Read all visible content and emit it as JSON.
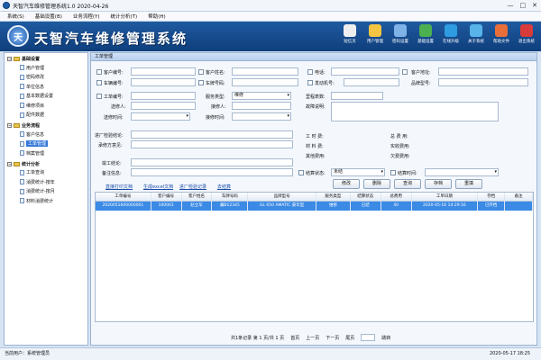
{
  "window": {
    "title": "天智汽车维修管理系统1.0 2020-04-26",
    "min_glyph": "—",
    "max_glyph": "□",
    "close_glyph": "✕"
  },
  "menu": [
    "系统(S)",
    "基础设置(B)",
    "业务流程(Y)",
    "统计分析(T)",
    "帮助(H)"
  ],
  "banner": {
    "title": "天智汽车维修管理系统",
    "logo_glyph": "天"
  },
  "toolbar": [
    {
      "label": "短信页",
      "color": "#eeeeee"
    },
    {
      "label": "用户管理",
      "color": "#f4c542"
    },
    {
      "label": "密码设置",
      "color": "#7fb3e8"
    },
    {
      "label": "基础设置",
      "color": "#4caf50"
    },
    {
      "label": "在线升级",
      "color": "#2f9be0"
    },
    {
      "label": "关于系统",
      "color": "#58b4e8"
    },
    {
      "label": "帮助文件",
      "color": "#e86f3a"
    },
    {
      "label": "退出系统",
      "color": "#d93a3a"
    }
  ],
  "sidebar": {
    "categories": [
      {
        "label": "基础设置",
        "items": [
          "用户管理",
          "密码修改",
          "单位信息",
          "基本数据设置",
          "维修项目",
          "配件数据"
        ]
      },
      {
        "label": "业务流程",
        "items": [
          "客户信息",
          "工单管理",
          "档案管理"
        ]
      },
      {
        "label": "统计分析",
        "items": [
          "工单查询",
          "消费统计-按年",
          "消费统计-按月",
          "材料消费统计"
        ]
      }
    ],
    "selected": "工单管理"
  },
  "panel": {
    "title": "工单管理"
  },
  "form": {
    "customer_id": "客户编号:",
    "customer_name": "客户姓名:",
    "phone": "电话:",
    "customer_address": "客户地址:",
    "vehicle_id": "车辆编号:",
    "plate_no": "车牌号码:",
    "engine_no": "发动机号:",
    "model_no": "品牌型号:",
    "order_id": "工单编号:",
    "service_type": "服务类型:",
    "service_type_value": "维修",
    "mileage": "里程表数:",
    "sender": "送修人:",
    "receiver": "接修人:",
    "fault_desc": "故障说明:",
    "send_time": "送修时间:",
    "receive_time": "接修时间:",
    "inspection": "进厂检验结论:",
    "labor_fee": "工 时 费:",
    "total_fee": "总 费 用:",
    "plan": "承修方意见:",
    "material_fee": "材 料 费:",
    "paid": "实收费用:",
    "other_fee": "其他费用:",
    "arrears": "欠费费用:",
    "completion": "竣工结论:",
    "remark": "备注信息:",
    "settle_status": "结算状态:",
    "settle_status_value": "未结",
    "settle_time": "结算时间:"
  },
  "links": [
    "直接打印文档",
    "生成excel文档",
    "进厂检验记录",
    "去结算"
  ],
  "buttons": [
    "修改",
    "删除",
    "查询",
    "存档",
    "重填"
  ],
  "table": {
    "columns": [
      "工单编号",
      "客户编号",
      "客户姓名",
      "车牌号码",
      "品牌型号",
      "服务类型",
      "结算状态",
      "总费用",
      "工单日期",
      "存档",
      "备注"
    ],
    "rows": [
      [
        "2020051600000001",
        "100001",
        "赵立军",
        "冀B12345",
        "GL 650 AMATIC 豪华型",
        "维修",
        "已结",
        "40",
        "2020-05-16 14:29:16",
        "已存档",
        ""
      ]
    ]
  },
  "pager": {
    "summary": "共1条记录 第 1 页/共 1 页",
    "first": "首页",
    "prev": "上一页",
    "next": "下一页",
    "last": "尾页",
    "go": "跳转"
  },
  "status": {
    "user": "当前用户：系统管理员",
    "datetime": "2020-05-17 18:25"
  }
}
